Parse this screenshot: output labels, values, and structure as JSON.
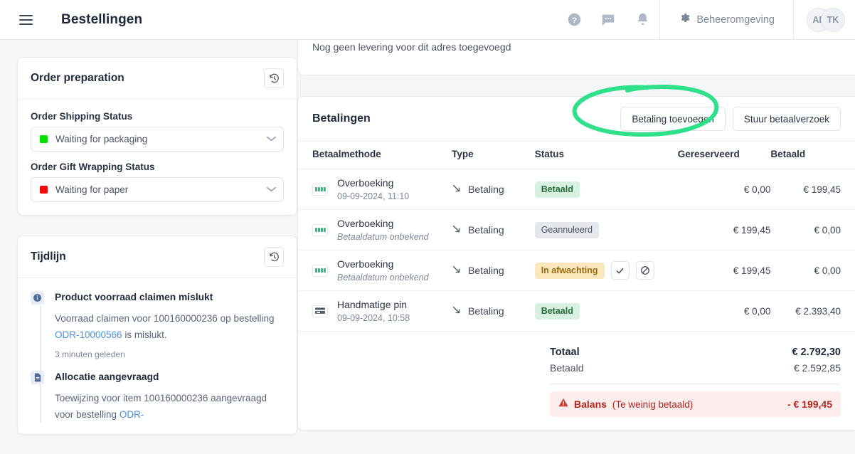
{
  "header": {
    "menu_icon": "hamburger-menu-icon",
    "title": "Bestellingen",
    "help_icon": "help-circle-icon",
    "chat_icon": "chat-bubble-icon",
    "bell_icon": "notification-bell-icon",
    "gear_icon": "gear-icon",
    "admin_label": "Beheeromgeving",
    "avatar_back": "AE",
    "avatar_front": "TK"
  },
  "order_preparation": {
    "title": "Order preparation",
    "history_icon": "history-clock-icon",
    "fields": [
      {
        "label": "Order Shipping Status",
        "value": "Waiting for packaging",
        "color": "#00e000",
        "chevron": "chevron-down-icon"
      },
      {
        "label": "Order Gift Wrapping Status",
        "value": "Waiting for paper",
        "color": "#f00a0a",
        "chevron": "chevron-down-icon"
      }
    ]
  },
  "timeline": {
    "title": "Tijdlijn",
    "history_icon": "history-clock-icon",
    "items": [
      {
        "icon": "info-circle-icon",
        "title": "Product voorraad claimen mislukt",
        "desc_before": "Voorraad claimen voor 100160000236 op bestelling ",
        "link": "ODR-10000566",
        "desc_after": " is mislukt.",
        "time": "3 minuten geleden"
      },
      {
        "icon": "document-icon",
        "title": "Allocatie aangevraagd",
        "desc_before": "Toewijzing voor item 100160000236 aangevraagd voor bestelling ",
        "link": "ODR-",
        "desc_after": "",
        "time": ""
      }
    ]
  },
  "delivery_stub": {
    "text": "Nog geen levering voor dit adres toegevoegd"
  },
  "payments": {
    "title": "Betalingen",
    "add_payment_button": "Betaling toevoegen",
    "send_request_button": "Stuur betaalverzoek",
    "columns": {
      "method": "Betaalmethode",
      "type": "Type",
      "status": "Status",
      "reserved": "Gereserveerd",
      "paid": "Betaald"
    },
    "rows": [
      {
        "icon": "bank-transfer-icon",
        "method": "Overboeking",
        "sub": "09-09-2024, 11:10",
        "sub_italic": false,
        "type_icon": "arrow-down-right-icon",
        "type": "Betaling",
        "status": "Betaald",
        "status_class": "paid",
        "actions": [],
        "reserved": "€ 0,00",
        "paid": "€ 199,45"
      },
      {
        "icon": "bank-transfer-icon",
        "method": "Overboeking",
        "sub": "Betaaldatum onbekend",
        "sub_italic": true,
        "type_icon": "arrow-down-right-icon",
        "type": "Betaling",
        "status": "Geannuleerd",
        "status_class": "cancelled",
        "actions": [],
        "reserved": "€ 199,45",
        "paid": "€ 0,00"
      },
      {
        "icon": "bank-transfer-icon",
        "method": "Overboeking",
        "sub": "Betaaldatum onbekend",
        "sub_italic": true,
        "type_icon": "arrow-down-right-icon",
        "type": "Betaling",
        "status": "In afwachting",
        "status_class": "pending",
        "actions": [
          "check-icon",
          "ban-icon"
        ],
        "reserved": "€ 199,45",
        "paid": "€ 0,00"
      },
      {
        "icon": "manual-card-icon",
        "method": "Handmatige pin",
        "sub": "09-09-2024, 10:58",
        "sub_italic": false,
        "type_icon": "arrow-down-right-icon",
        "type": "Betaling",
        "status": "Betaald",
        "status_class": "paid",
        "actions": [],
        "reserved": "€ 0,00",
        "paid": "€ 2.393,40"
      }
    ],
    "totals": {
      "total_label": "Totaal",
      "total_value": "€ 2.792,30",
      "paid_label": "Betaald",
      "paid_value": "€ 2.592,85",
      "balance_icon": "warning-triangle-icon",
      "balance_label": "Balans",
      "balance_note": "(Te weinig betaald)",
      "balance_value": "- € 199,45"
    }
  },
  "annotation": {
    "shape": "ellipse-highlight",
    "color": "#2fe08a",
    "target": "Betaling toevoegen"
  }
}
